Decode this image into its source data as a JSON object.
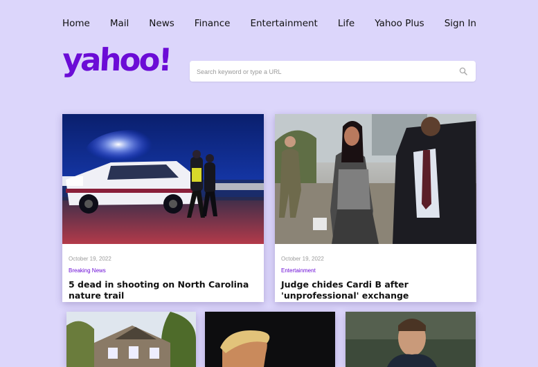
{
  "nav": {
    "items": [
      "Home",
      "Mail",
      "News",
      "Finance",
      "Entertainment",
      "Life",
      "Yahoo Plus",
      "Sign In"
    ]
  },
  "logo": {
    "text": "yahoo!"
  },
  "search": {
    "placeholder": "Search keyword or type a URL"
  },
  "colors": {
    "accent": "#6b0cd6",
    "background": "#dcd6fb"
  },
  "cards": [
    {
      "date": "October 19, 2022",
      "category": "Breaking News",
      "title": "5 dead in shooting on North Carolina nature trail",
      "image": "police-car-night-scene"
    },
    {
      "date": "October 19, 2022",
      "category": "Entertainment",
      "title": "Judge chides Cardi B after 'unprofessional' exchange",
      "image": "cardi-b-court-walk"
    }
  ],
  "small_cards": [
    {
      "image": "suburban-house"
    },
    {
      "image": "trump-portrait"
    },
    {
      "image": "tom-brady-portrait"
    }
  ]
}
